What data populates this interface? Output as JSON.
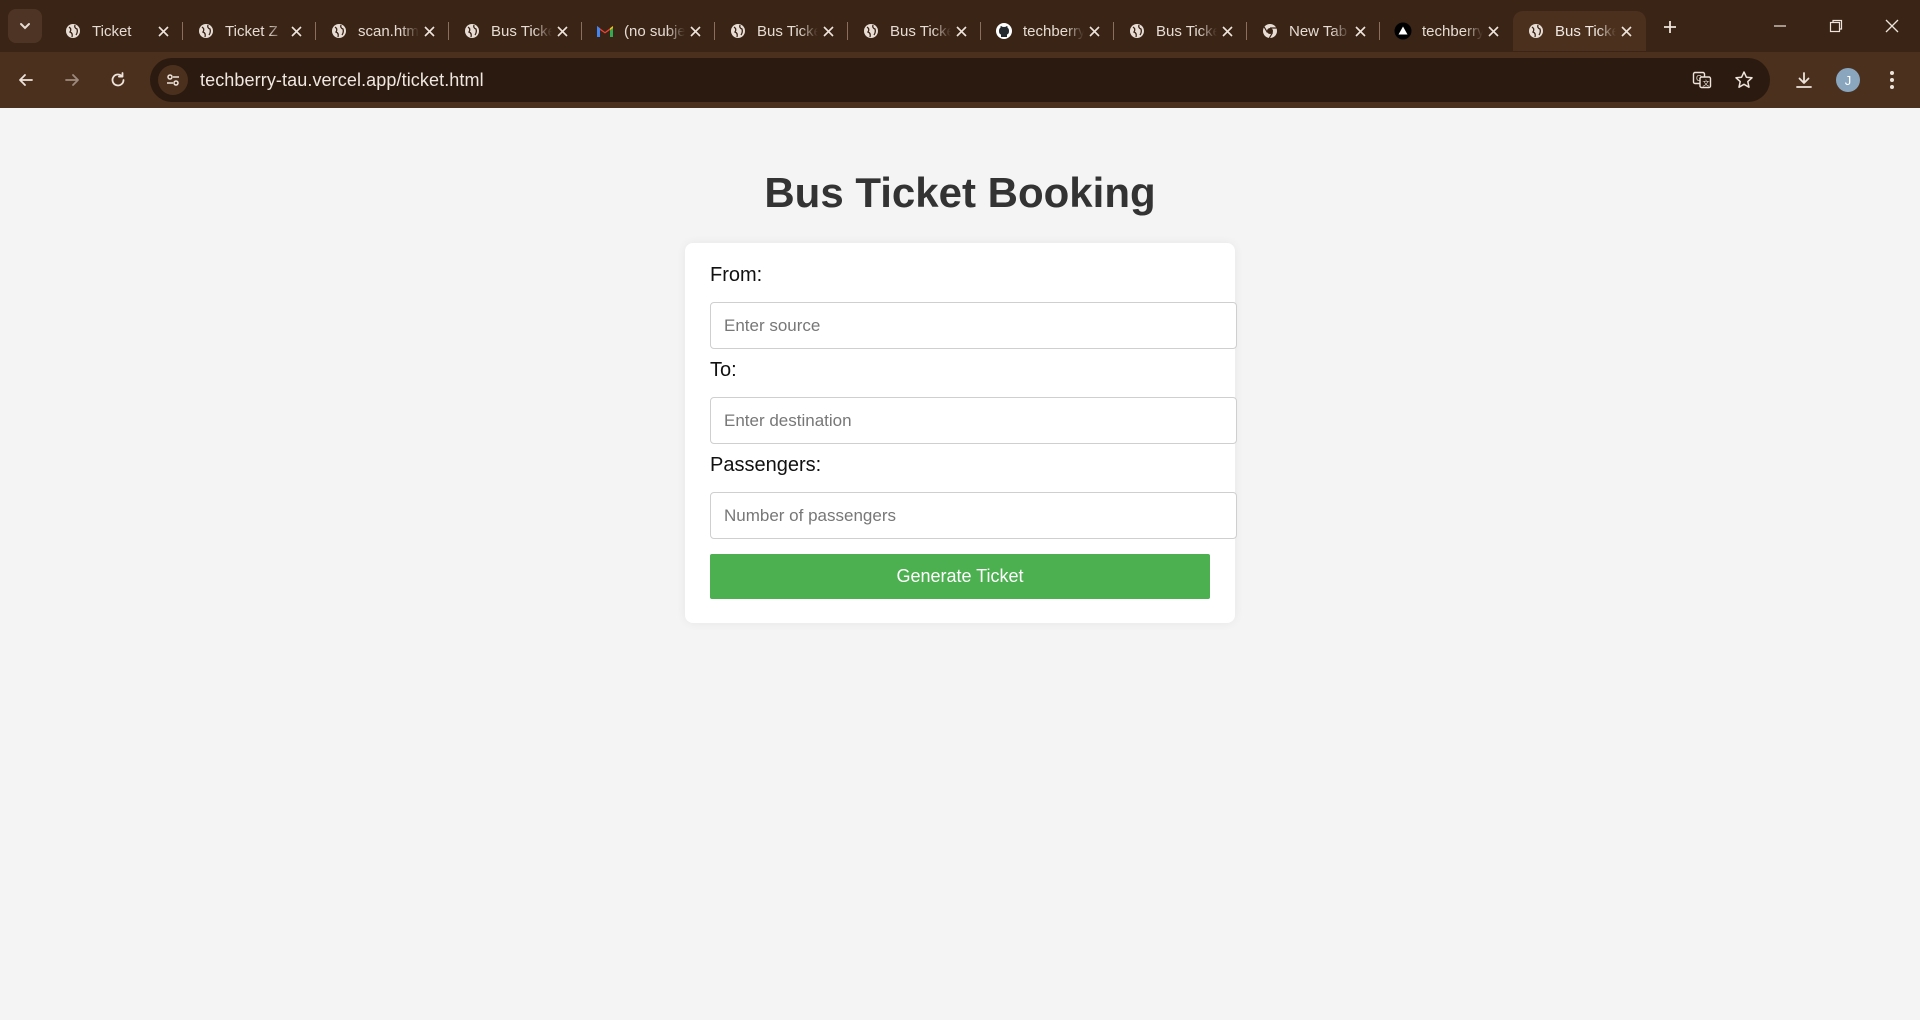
{
  "browser": {
    "tabs": [
      {
        "title": "Ticket",
        "icon": "globe-icon"
      },
      {
        "title": "Ticket Z",
        "icon": "globe-icon"
      },
      {
        "title": "scan.html",
        "icon": "globe-icon"
      },
      {
        "title": "Bus Ticket",
        "icon": "globe-icon"
      },
      {
        "title": "(no subject)",
        "icon": "gmail-icon"
      },
      {
        "title": "Bus Ticket",
        "icon": "globe-icon"
      },
      {
        "title": "Bus Ticket",
        "icon": "globe-icon"
      },
      {
        "title": "techberry",
        "icon": "github-icon"
      },
      {
        "title": "Bus Ticket",
        "icon": "globe-icon"
      },
      {
        "title": "New Tab",
        "icon": "chrome-icon"
      },
      {
        "title": "techberry",
        "icon": "vercel-icon"
      },
      {
        "title": "Bus Ticket",
        "icon": "globe-icon",
        "active": true
      }
    ],
    "url": "techberry-tau.vercel.app/ticket.html",
    "profile_initial": "J",
    "colors": {
      "frame": "#3a2416",
      "toolbar": "#4b301d",
      "omnibox": "#2b1a0f"
    }
  },
  "page": {
    "title": "Bus Ticket Booking",
    "form": {
      "from_label": "From:",
      "from_placeholder": "Enter source",
      "to_label": "To:",
      "to_placeholder": "Enter destination",
      "passengers_label": "Passengers:",
      "passengers_placeholder": "Number of passengers",
      "submit_label": "Generate Ticket"
    },
    "colors": {
      "background": "#f4f4f4",
      "button": "#4caf50",
      "title": "#333333"
    }
  }
}
